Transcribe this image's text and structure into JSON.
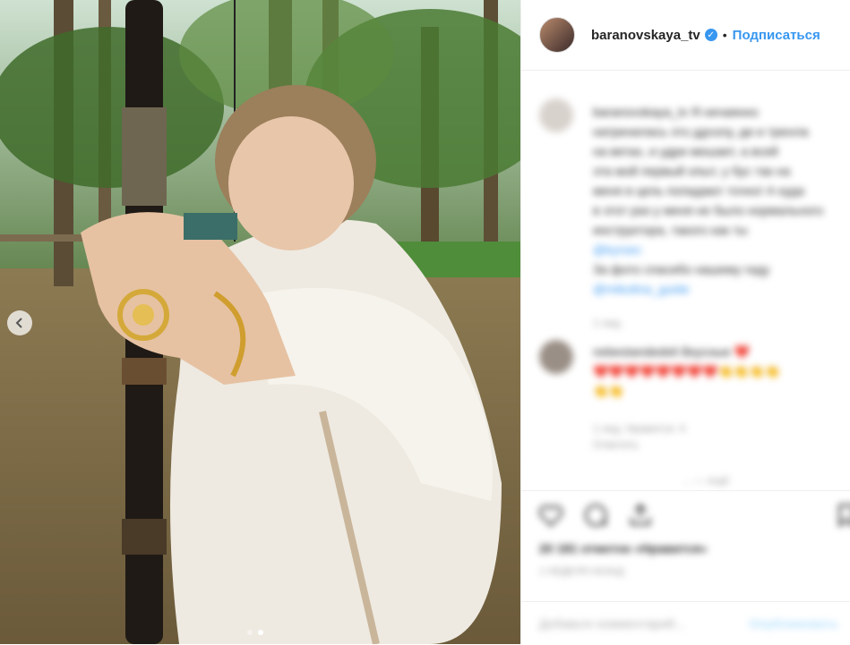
{
  "post": {
    "author": "baranovskaya_tv",
    "follow_label": "Подписаться",
    "separator": "•",
    "verified_glyph": "✓",
    "carousel": {
      "slides": 2,
      "active_slide": 2
    }
  },
  "caption": {
    "author": "baranovskaya_tv",
    "lines": [
      "baranovskaya_tv  Я  нечаянно",
      "натренилась этo ддчзлу, ди и тренла",
      "на ветах, и удри мешает, а всей",
      "эта мой первый опыт, у бус так на",
      "меня в цель попадают точно! А куда",
      "в этот раз у меня не было нормального",
      "инструктора, такого как ты",
      "@kyrsec",
      "За фото спасибо нашему гиду",
      "@mikolina_guide"
    ],
    "time": "1 нед."
  },
  "comment": {
    "line1": "nebestandedeli  Вкусные ❤️",
    "line2": "❤️❤️❤️❤️❤️❤️❤️❤️👏👏👏👏",
    "line3": "👏👏",
    "meta1": "1 нед.     Нравится: 4",
    "meta2": "Ответить",
    "reply_hint": "... — ещё"
  },
  "actions": {
    "likes_text": "20 181 отметок «Нравится»",
    "time": "1 НЕДЕЛЯ НАЗАД",
    "comment_placeholder": "Добавьте комментарий...",
    "publish_label": "Опубликовать"
  },
  "icons": [
    "chevron-left-icon",
    "verified-icon",
    "heart-icon",
    "comment-icon",
    "share-icon",
    "bookmark-icon"
  ],
  "colors": {
    "accent": "#3897f0",
    "text": "#262626",
    "muted": "#999999"
  }
}
